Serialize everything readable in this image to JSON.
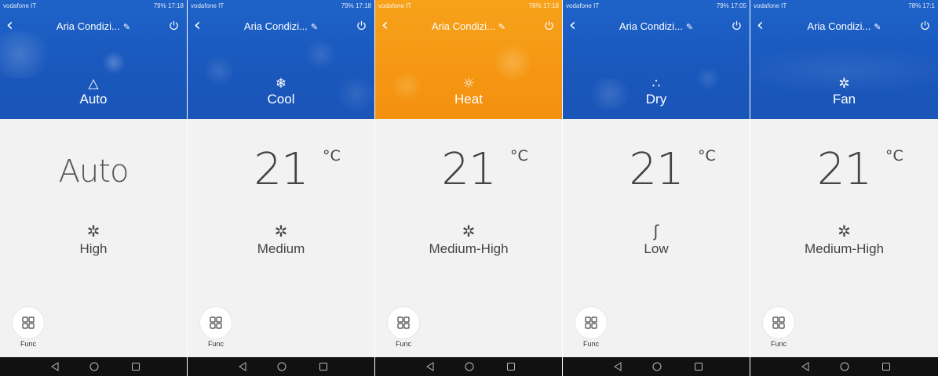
{
  "panels": [
    {
      "carrier": "vodafone IT",
      "status_right": "79% 17:18",
      "header_color": "#1b5cc4",
      "back_icon": "chevron-left-icon",
      "title": "Aria Condizi...",
      "edit_icon": "pencil-icon",
      "power_icon": "power-icon",
      "mode_icon": "auto-mode-icon",
      "mode_glyph": "△",
      "mode": "Auto",
      "temperature": "Auto",
      "unit": "",
      "fan_icon": "fan-icon",
      "fan_glyph": "✲",
      "fan_speed": "High",
      "func_icon": "grid-icon",
      "func_label": "Func"
    },
    {
      "carrier": "vodafone IT",
      "status_right": "79% 17:18",
      "header_color": "#1b5cc4",
      "back_icon": "chevron-left-icon",
      "title": "Aria Condizi...",
      "edit_icon": "pencil-icon",
      "power_icon": "power-icon",
      "mode_icon": "snowflake-icon",
      "mode_glyph": "❄",
      "mode": "Cool",
      "temperature": "21",
      "unit": "°C",
      "fan_icon": "fan-icon",
      "fan_glyph": "✲",
      "fan_speed": "Medium",
      "func_icon": "grid-icon",
      "func_label": "Func"
    },
    {
      "carrier": "vodafone IT",
      "status_right": "78% 17:18",
      "header_color": "#f59a14",
      "back_icon": "chevron-left-icon",
      "title": "Aria Condizi...",
      "edit_icon": "pencil-icon",
      "power_icon": "power-icon",
      "mode_icon": "sun-icon",
      "mode_glyph": "☼",
      "mode": "Heat",
      "temperature": "21",
      "unit": "°C",
      "fan_icon": "fan-icon",
      "fan_glyph": "✲",
      "fan_speed": "Medium-High",
      "func_icon": "grid-icon",
      "func_label": "Func"
    },
    {
      "carrier": "vodafone IT",
      "status_right": "79% 17:05",
      "header_color": "#1b5cc4",
      "back_icon": "chevron-left-icon",
      "title": "Aria Condizi...",
      "edit_icon": "pencil-icon",
      "power_icon": "power-icon",
      "mode_icon": "droplets-icon",
      "mode_glyph": "∴",
      "mode": "Dry",
      "temperature": "21",
      "unit": "°C",
      "fan_icon": "fan-low-icon",
      "fan_glyph": "ʃ",
      "fan_speed": "Low",
      "func_icon": "grid-icon",
      "func_label": "Func"
    },
    {
      "carrier": "vodafone IT",
      "status_right": "78% 17:1",
      "header_color": "#1b5cc4",
      "back_icon": "chevron-left-icon",
      "title": "Aria Condizi...",
      "edit_icon": "pencil-icon",
      "power_icon": "power-icon",
      "mode_icon": "fan-icon",
      "mode_glyph": "✲",
      "mode": "Fan",
      "temperature": "21",
      "unit": "°C",
      "fan_icon": "fan-icon",
      "fan_glyph": "✲",
      "fan_speed": "Medium-High",
      "func_icon": "grid-icon",
      "func_label": "Func"
    }
  ],
  "navbar": {
    "back_icon": "triangle-back-icon",
    "home_icon": "circle-home-icon",
    "recent_icon": "square-recents-icon"
  }
}
